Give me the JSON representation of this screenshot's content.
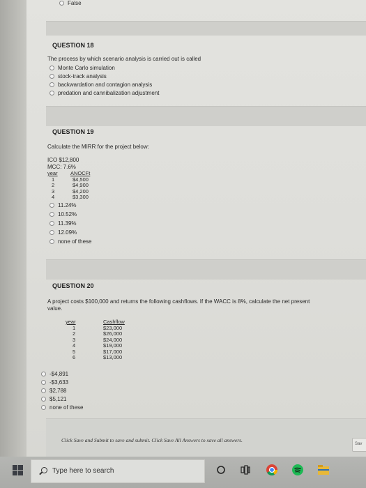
{
  "top_option": "False",
  "q18": {
    "title": "QUESTION 18",
    "prompt": "The process by which scenario analysis is carried out is called",
    "options": [
      "Monte Carlo simulation",
      "stock-track analysis",
      "backwardation and contagion analysis",
      "predation and cannibalization adjustment"
    ]
  },
  "q19": {
    "title": "QUESTION 19",
    "prompt": "Calculate the MIRR for the project below:",
    "ico": "ICO $12,800",
    "mcc": "MCC: 7.6%",
    "col_year": "year",
    "col_anocf": "ANOCFt",
    "rows": [
      [
        "1",
        "$4,500"
      ],
      [
        "2",
        "$4,900"
      ],
      [
        "3",
        "$4,200"
      ],
      [
        "4",
        "$3,300"
      ]
    ],
    "options": [
      "11.24%",
      "10.52%",
      "11.39%",
      "12.09%",
      "none of these"
    ]
  },
  "q20": {
    "title": "QUESTION 20",
    "prompt_line1": "A project costs $100,000 and returns the following cashflows. If the WACC is 8%, calculate the net present",
    "prompt_line2": "value.",
    "col_year": "year",
    "col_cashflow": "Cashflow",
    "rows": [
      [
        "1",
        "$23,000"
      ],
      [
        "2",
        "$26,000"
      ],
      [
        "3",
        "$24,000"
      ],
      [
        "4",
        "$19,000"
      ],
      [
        "5",
        "$17,000"
      ],
      [
        "6",
        "$13,000"
      ]
    ],
    "options": [
      "-$4,891",
      "-$3,633",
      "$2,788",
      "$5,121",
      "none of these"
    ]
  },
  "footer": {
    "instruction": "Click Save and Submit to save and submit. Click Save All Answers to save all answers.",
    "save_all_label": "Sav"
  },
  "taskbar": {
    "search_placeholder": "Type here to search",
    "icons": [
      "windows-start-icon",
      "cortana-circle-icon",
      "task-view-icon",
      "chrome-icon",
      "spotify-icon",
      "file-explorer-icon"
    ]
  }
}
